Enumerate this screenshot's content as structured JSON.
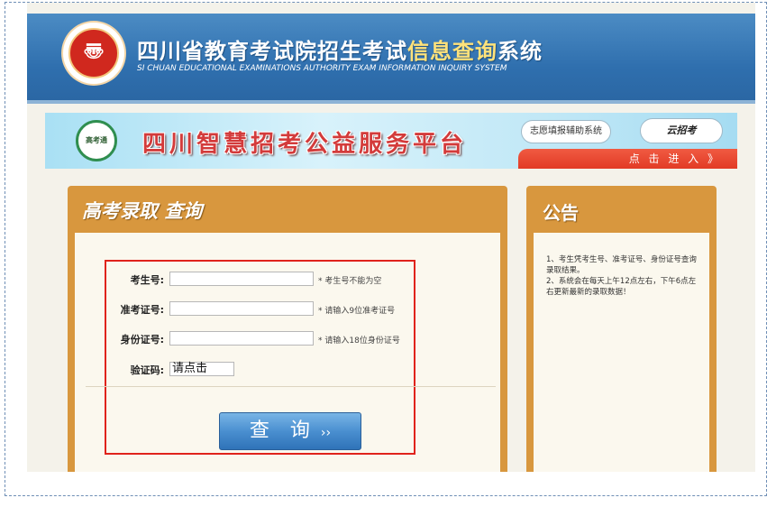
{
  "header": {
    "title_prefix": "四川省教育考试院招生考试",
    "title_highlight": "信息查询",
    "title_suffix": "系统",
    "subtitle": "SI CHUAN EDUCATIONAL EXAMINATIONS AUTHORITY EXAM INFORMATION INQUIRY SYSTEM"
  },
  "banner": {
    "logo_text": "高考通",
    "title": "四川智慧招考公益服务平台",
    "volunteer_button": "志愿填报辅助系统",
    "sign_button": "云招考",
    "enter_text": "点 击 进 入 》"
  },
  "main": {
    "title": "高考录取 查询",
    "fields": [
      {
        "label": "考生号:",
        "value": "",
        "hint": "* 考生号不能为空"
      },
      {
        "label": "准考证号:",
        "value": "",
        "hint": "* 请输入9位准考证号"
      },
      {
        "label": "身份证号:",
        "value": "",
        "hint": "* 请输入18位身份证号"
      }
    ],
    "captcha": {
      "label": "验证码:",
      "value": "请点击"
    },
    "query_button": "查 询",
    "query_arrow": "››"
  },
  "notice": {
    "title": "公告",
    "line1": "1、考生凭考生号、准考证号、身份证号查询录取结果。",
    "line2": "2、系统会在每天上午12点左右，下午6点左右更新最新的录取数据！"
  },
  "colors": {
    "header_blue": "#2f6fae",
    "panel_orange": "#d8973e",
    "form_border_red": "#e0231c",
    "button_blue": "#4a8fd0"
  }
}
